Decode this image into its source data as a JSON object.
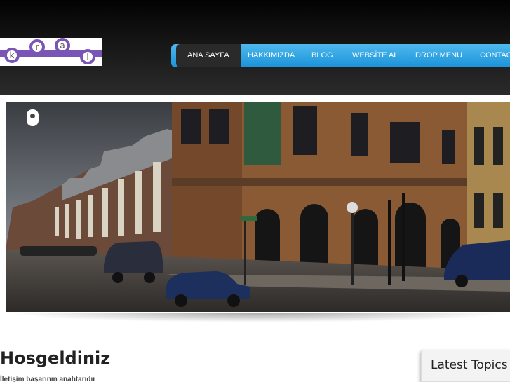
{
  "logo": {
    "letters": [
      "k",
      "r",
      "a",
      "l"
    ],
    "accent_color": "#7b55b6"
  },
  "nav": {
    "items": [
      {
        "label": "ANA SAYFA",
        "active": true
      },
      {
        "label": "HAKKIMIZDA",
        "active": false
      },
      {
        "label": "BLOG",
        "active": false
      },
      {
        "label": "WEBSİTE AL",
        "active": false
      },
      {
        "label": "DROP MENU",
        "active": false
      },
      {
        "label": "CONTACT",
        "active": false
      }
    ],
    "bar_color": "#1b93d8",
    "active_color": "#2a2a2a"
  },
  "slider": {
    "image": "street-corner-photo",
    "icon": "slider-indicator-icon"
  },
  "content": {
    "title": "Hosgeldiniz",
    "subtitle": "İletişim başarının anahtarıdır"
  },
  "sidebar": {
    "title": "Latest Topics"
  }
}
